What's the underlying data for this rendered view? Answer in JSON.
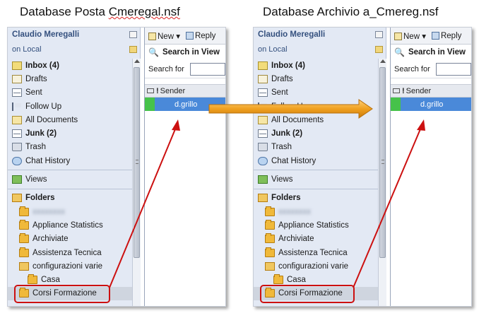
{
  "captions": {
    "left_prefix": "Database Posta ",
    "left_file": "Cmeregal.nsf",
    "right": "Database Archivio a_Cmereg.nsf"
  },
  "panel": {
    "user": "Claudio Meregalli",
    "location": "on Local",
    "nav": {
      "inbox": "Inbox (4)",
      "drafts": "Drafts",
      "sent": "Sent",
      "follow_up": "Follow Up",
      "all_documents": "All Documents",
      "junk": "Junk (2)",
      "trash": "Trash",
      "chat_history": "Chat History",
      "views": "Views",
      "folders": "Folders",
      "folder_blurred": "xxxxxxxx",
      "appliance_statistics": "Appliance Statistics",
      "archiviate": "Archiviate",
      "assistenza_tecnica": "Assistenza Tecnica",
      "configurazioni_varie": "configurazioni varie",
      "casa": "Casa",
      "corsi_formazione": "Corsi Formazione"
    },
    "toolbar": {
      "new": "New",
      "reply": "Reply"
    },
    "search": {
      "title": "Search in View",
      "label": "Search for",
      "value": ""
    },
    "columns": {
      "sender": "Sender"
    },
    "rows": [
      {
        "sender": "d.grillo"
      }
    ]
  },
  "colors": {
    "arrow": "#f0a020",
    "highlight": "#cc1010",
    "selected_row": "#4a89d9",
    "unread_mark": "#46c24a"
  }
}
